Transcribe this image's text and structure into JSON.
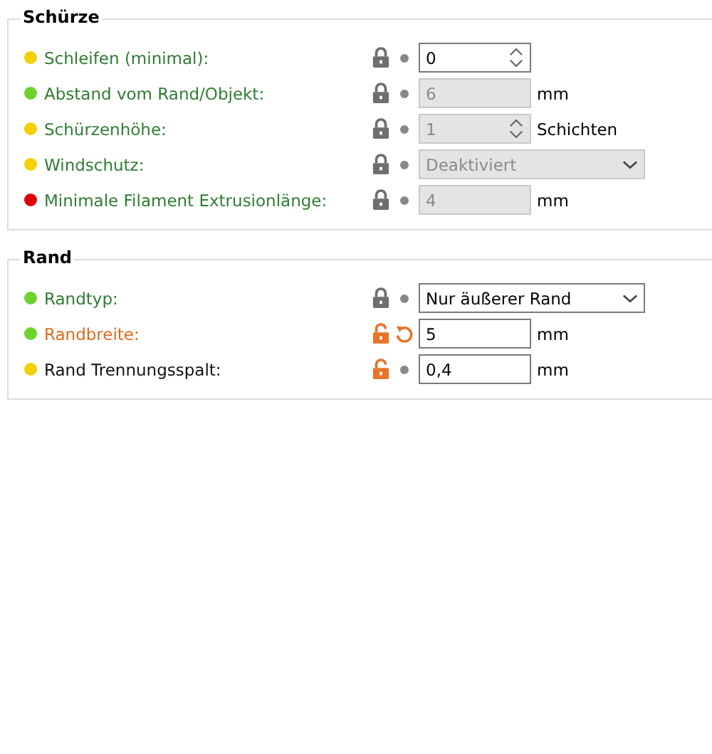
{
  "groups": [
    {
      "title": "Schürze",
      "rows": [
        {
          "label": {
            "text": "Schleifen (minimal):",
            "kind": "system"
          },
          "color": "#f5d000",
          "locked": true,
          "reset": false,
          "kind": "spin",
          "value": "0",
          "disabled": false
        },
        {
          "label": {
            "text": "Abstand vom Rand/Objekt:",
            "kind": "system"
          },
          "color": "#6cd42c",
          "locked": true,
          "reset": false,
          "kind": "number",
          "value": "6",
          "unit": "mm",
          "disabled": true
        },
        {
          "label": {
            "text": "Schürzenhöhe:",
            "kind": "system"
          },
          "color": "#f5d000",
          "locked": true,
          "reset": false,
          "kind": "spin",
          "value": "1",
          "unit": "Schichten",
          "disabled": true
        },
        {
          "label": {
            "text": "Windschutz:",
            "kind": "system"
          },
          "color": "#f5d000",
          "locked": true,
          "reset": false,
          "kind": "select",
          "value": "Deaktiviert",
          "disabled": true
        },
        {
          "label": {
            "text": "Minimale Filament Extrusionlänge:",
            "kind": "system"
          },
          "color": "#e00000",
          "locked": true,
          "reset": false,
          "kind": "number",
          "value": "4",
          "unit": "mm",
          "disabled": true
        }
      ]
    },
    {
      "title": "Rand",
      "rows": [
        {
          "label": {
            "text": "Randtyp:",
            "kind": "system"
          },
          "color": "#6cd42c",
          "locked": true,
          "reset": false,
          "kind": "select",
          "value": "Nur äußerer Rand",
          "disabled": false
        },
        {
          "label": {
            "text": "Randbreite:",
            "kind": "modified"
          },
          "color": "#6cd42c",
          "locked": false,
          "reset": true,
          "kind": "number",
          "value": "5",
          "unit": "mm",
          "disabled": false
        },
        {
          "label": {
            "text": "Rand Trennungsspalt:",
            "kind": "default"
          },
          "color": "#f5d000",
          "locked": false,
          "reset": false,
          "kind": "number",
          "value": "0,4",
          "unit": "mm",
          "disabled": false
        }
      ]
    }
  ]
}
